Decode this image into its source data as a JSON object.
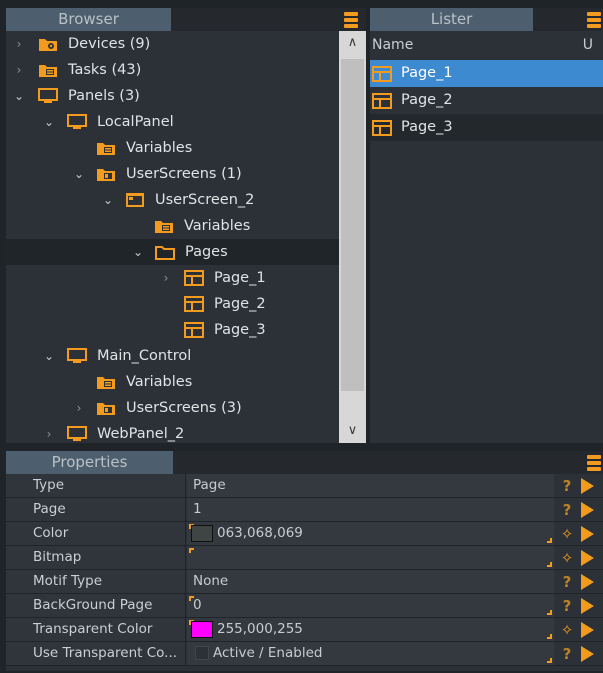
{
  "colors": {
    "accent": "#f29b1f",
    "selection": "#3d8ad0",
    "magenta": "#ff00ff",
    "dark_swatch": "#3f4445"
  },
  "browser": {
    "title": "Browser",
    "menu_icon": "hamburger-icon",
    "tree": [
      {
        "label": "Devices (9)",
        "icon": "folder-gear-icon",
        "chevron": "right"
      },
      {
        "label": "Tasks (43)",
        "icon": "folder-stack-icon",
        "chevron": "right"
      },
      {
        "label": "Panels (3)",
        "icon": "monitor-icon",
        "chevron": "down"
      },
      {
        "label": "LocalPanel",
        "icon": "monitor-icon",
        "chevron": "down"
      },
      {
        "label": "Variables",
        "icon": "folder-stack-icon",
        "chevron": ""
      },
      {
        "label": "UserScreens (1)",
        "icon": "folder-screen-icon",
        "chevron": "down"
      },
      {
        "label": "UserScreen_2",
        "icon": "screen-window-icon",
        "chevron": "down"
      },
      {
        "label": "Variables",
        "icon": "folder-stack-icon",
        "chevron": ""
      },
      {
        "label": "Pages",
        "icon": "folder-open-icon",
        "chevron": "down"
      },
      {
        "label": "Page_1",
        "icon": "page-grid-icon",
        "chevron": "right"
      },
      {
        "label": "Page_2",
        "icon": "page-grid-icon",
        "chevron": ""
      },
      {
        "label": "Page_3",
        "icon": "page-grid-icon",
        "chevron": ""
      },
      {
        "label": "Main_Control",
        "icon": "monitor-icon",
        "chevron": "down"
      },
      {
        "label": "Variables",
        "icon": "folder-stack-icon",
        "chevron": ""
      },
      {
        "label": "UserScreens (3)",
        "icon": "folder-screen-icon",
        "chevron": "right"
      },
      {
        "label": "WebPanel_2",
        "icon": "monitor-icon",
        "chevron": "right"
      }
    ],
    "scroll_up": "^",
    "scroll_down": "v"
  },
  "lister": {
    "title": "Lister",
    "col_name": "Name",
    "col_u": "U",
    "items": [
      "Page_1",
      "Page_2",
      "Page_3"
    ]
  },
  "properties": {
    "title": "Properties",
    "rows": [
      {
        "name": "Type",
        "value": "Page",
        "action": "?"
      },
      {
        "name": "Page",
        "value": "1",
        "action": "?"
      },
      {
        "name": "Color",
        "value": "063,068,069",
        "action": "wand"
      },
      {
        "name": "Bitmap",
        "value": "",
        "action": "wand"
      },
      {
        "name": "Motif Type",
        "value": "None",
        "action": "?"
      },
      {
        "name": "BackGround Page",
        "value": "0",
        "action": "?"
      },
      {
        "name": "Transparent Color",
        "value": "255,000,255",
        "action": "wand"
      },
      {
        "name": "Use Transparent Co...",
        "value": "Active / Enabled",
        "action": "?"
      }
    ]
  }
}
